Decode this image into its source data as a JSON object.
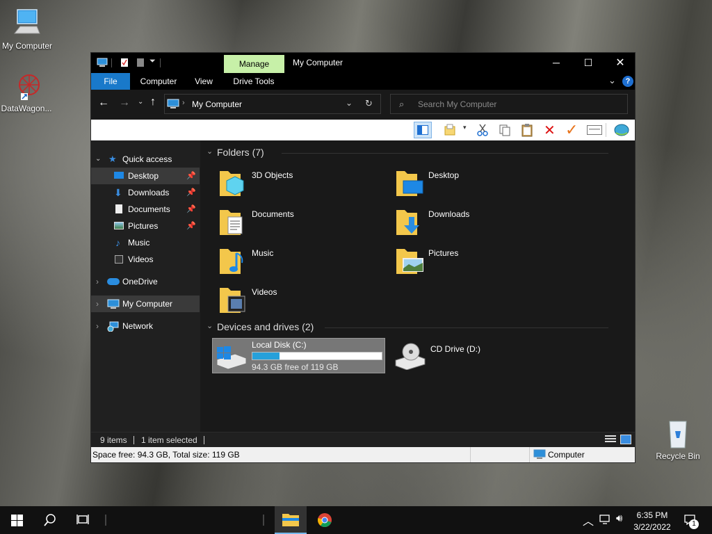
{
  "desktop": {
    "icons": [
      {
        "label": "My Computer"
      },
      {
        "label": "DataWagon..."
      },
      {
        "label": "Recycle Bin"
      }
    ]
  },
  "window": {
    "title": "My Computer",
    "manage_tab": "Manage",
    "tabs": [
      "File",
      "Computer",
      "View",
      "Drive Tools"
    ],
    "address": "My Computer",
    "search_placeholder": "Search My Computer"
  },
  "nav": {
    "quick_access": "Quick access",
    "quick_items": [
      {
        "label": "Desktop",
        "pinned": true
      },
      {
        "label": "Downloads",
        "pinned": true
      },
      {
        "label": "Documents",
        "pinned": true
      },
      {
        "label": "Pictures",
        "pinned": true
      },
      {
        "label": "Music",
        "pinned": false
      },
      {
        "label": "Videos",
        "pinned": false
      }
    ],
    "onedrive": "OneDrive",
    "my_computer": "My Computer",
    "network": "Network"
  },
  "content": {
    "folders_header": "Folders (7)",
    "folders": [
      "3D Objects",
      "Desktop",
      "Documents",
      "Downloads",
      "Music",
      "Pictures",
      "Videos"
    ],
    "devices_header": "Devices and drives (2)",
    "drives": [
      {
        "name": "Local Disk (C:)",
        "free": "94.3 GB free of 119 GB",
        "used_fraction": 0.21
      },
      {
        "name": "CD Drive (D:)"
      }
    ]
  },
  "status": {
    "items": "9 items",
    "selected": "1 item selected",
    "space": "Space free: 94.3 GB, Total size: 119 GB",
    "location": "Computer"
  },
  "taskbar": {
    "time": "6:35 PM",
    "date": "3/22/2022",
    "notifications": "1"
  }
}
